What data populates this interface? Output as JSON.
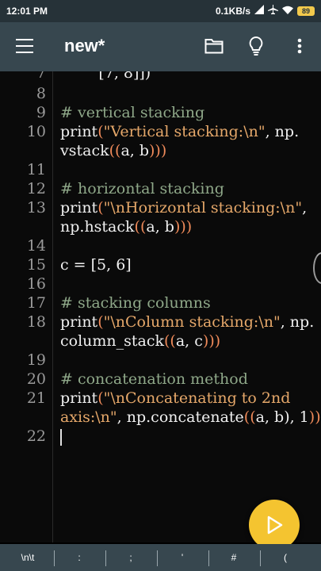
{
  "status_bar": {
    "time": "12:01 PM",
    "network_speed": "0.1KB/s",
    "battery": "89"
  },
  "toolbar": {
    "title": "new*"
  },
  "editor": {
    "lines": [
      {
        "num": "7",
        "parts": [
          {
            "t": "        [7, 8]])",
            "c": ""
          }
        ]
      },
      {
        "num": "8",
        "parts": []
      },
      {
        "num": "9",
        "parts": [
          {
            "t": "# vertical stacking",
            "c": "cm"
          }
        ]
      },
      {
        "num": "10",
        "parts": [
          {
            "t": "print",
            "c": ""
          },
          {
            "t": "(",
            "c": "par"
          },
          {
            "t": "\"Vertical stacking:\\n\"",
            "c": "str"
          },
          {
            "t": ", np.",
            "c": ""
          }
        ]
      },
      {
        "num": "",
        "parts": [
          {
            "t": "vstack",
            "c": ""
          },
          {
            "t": "((",
            "c": "par"
          },
          {
            "t": "a, b",
            "c": ""
          },
          {
            "t": ")))",
            "c": "par"
          }
        ]
      },
      {
        "num": "11",
        "parts": []
      },
      {
        "num": "12",
        "parts": [
          {
            "t": "# horizontal stacking",
            "c": "cm"
          }
        ]
      },
      {
        "num": "13",
        "parts": [
          {
            "t": "print",
            "c": ""
          },
          {
            "t": "(",
            "c": "par"
          },
          {
            "t": "\"\\nHorizontal stacking:\\n\"",
            "c": "str"
          },
          {
            "t": ",",
            "c": ""
          }
        ]
      },
      {
        "num": "",
        "parts": [
          {
            "t": "np.hstack",
            "c": ""
          },
          {
            "t": "((",
            "c": "par"
          },
          {
            "t": "a, b",
            "c": ""
          },
          {
            "t": ")))",
            "c": "par"
          }
        ]
      },
      {
        "num": "14",
        "parts": []
      },
      {
        "num": "15",
        "parts": [
          {
            "t": "c = [5, 6]",
            "c": ""
          }
        ]
      },
      {
        "num": "16",
        "parts": []
      },
      {
        "num": "17",
        "parts": [
          {
            "t": "# stacking columns",
            "c": "cm"
          }
        ]
      },
      {
        "num": "18",
        "parts": [
          {
            "t": "print",
            "c": ""
          },
          {
            "t": "(",
            "c": "par"
          },
          {
            "t": "\"\\nColumn stacking:\\n\"",
            "c": "str"
          },
          {
            "t": ", np.",
            "c": ""
          }
        ]
      },
      {
        "num": "",
        "parts": [
          {
            "t": "column_stack",
            "c": ""
          },
          {
            "t": "((",
            "c": "par"
          },
          {
            "t": "a, c",
            "c": ""
          },
          {
            "t": ")))",
            "c": "par"
          }
        ]
      },
      {
        "num": "19",
        "parts": []
      },
      {
        "num": "20",
        "parts": [
          {
            "t": "# concatenation method",
            "c": "cm"
          }
        ]
      },
      {
        "num": "21",
        "parts": [
          {
            "t": "print",
            "c": ""
          },
          {
            "t": "(",
            "c": "par"
          },
          {
            "t": "\"\\nConcatenating to 2nd",
            "c": "str"
          }
        ]
      },
      {
        "num": "",
        "parts": [
          {
            "t": "axis:\\n\"",
            "c": "str"
          },
          {
            "t": ", np.concatenate",
            "c": ""
          },
          {
            "t": "((",
            "c": "par"
          },
          {
            "t": "a, b), 1",
            "c": ""
          },
          {
            "t": "))",
            "c": "par"
          }
        ]
      },
      {
        "num": "22",
        "parts": [],
        "cursor": true
      }
    ]
  },
  "keybar": {
    "keys": [
      "\\n\\t",
      ":",
      ";",
      "'",
      "#",
      "("
    ]
  },
  "icons": {
    "menu": "menu-icon",
    "folder": "folder-icon",
    "bulb": "lightbulb-icon",
    "more": "more-vert-icon",
    "run": "play-icon"
  },
  "colors": {
    "toolbar": "#37474f",
    "fab": "#f4c430",
    "comment": "#8fa889",
    "string": "#e6a86a"
  }
}
